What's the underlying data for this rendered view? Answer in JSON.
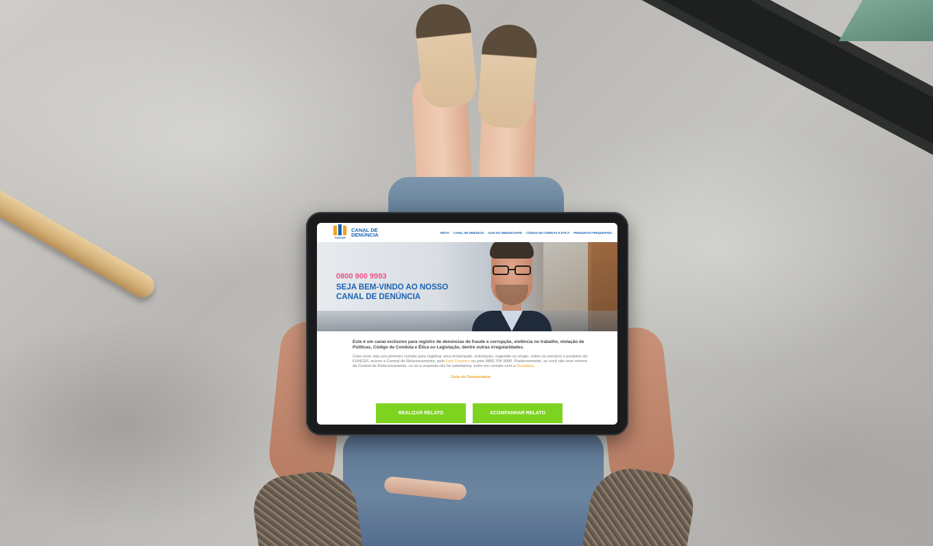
{
  "site": {
    "logo_brand": "FUNCEF",
    "logo_title": "CANAL DE DENÚNCIA"
  },
  "nav": {
    "items": [
      {
        "label": "INÍCIO"
      },
      {
        "label": "CANAL DE DENÚNCIA"
      },
      {
        "label": "GUIA DO DENUNCIANTE"
      },
      {
        "label": "CÓDIGO DE CONDUTA E ÉTICA"
      },
      {
        "label": "PERGUNTAS FREQUENTES"
      }
    ]
  },
  "hero": {
    "phone": "0800 900 9993",
    "title": "SEJA BEM-VINDO AO NOSSO CANAL DE DENÚNCIA"
  },
  "content": {
    "lead": "Este é um canal exclusivo para registro de denúncias de fraude e corrupção, violência no trabalho, violação de Políticas, Código de Conduta e Ética ou Legislação, dentre outras irregularidades.",
    "body_part1": "Caso esse seja seu primeiro contato para registrar uma reclamação, solicitação, sugestão ou elogio, sobre os serviços e produtos da FUNCEF, acione a Central de Relacionamento, pelo ",
    "link_contact": "Fale Conosco",
    "body_part2": " ou pelo 0800 706 9000. Posteriormente, se você não teve retorno da Central de Relacionamento, ou se a resposta não foi satisfatória, entre em contato com a ",
    "link_ombudsman": "Ouvidoria",
    "body_part3": ".",
    "guide_link": "Guia do Denunciante"
  },
  "actions": {
    "report": "REALIZAR RELATO",
    "track": "ACOMPANHAR RELATO"
  },
  "colors": {
    "brand_blue": "#1b63b1",
    "brand_orange": "#f4a11d",
    "phone_pink": "#ef4f86",
    "button_green": "#7ed321"
  }
}
